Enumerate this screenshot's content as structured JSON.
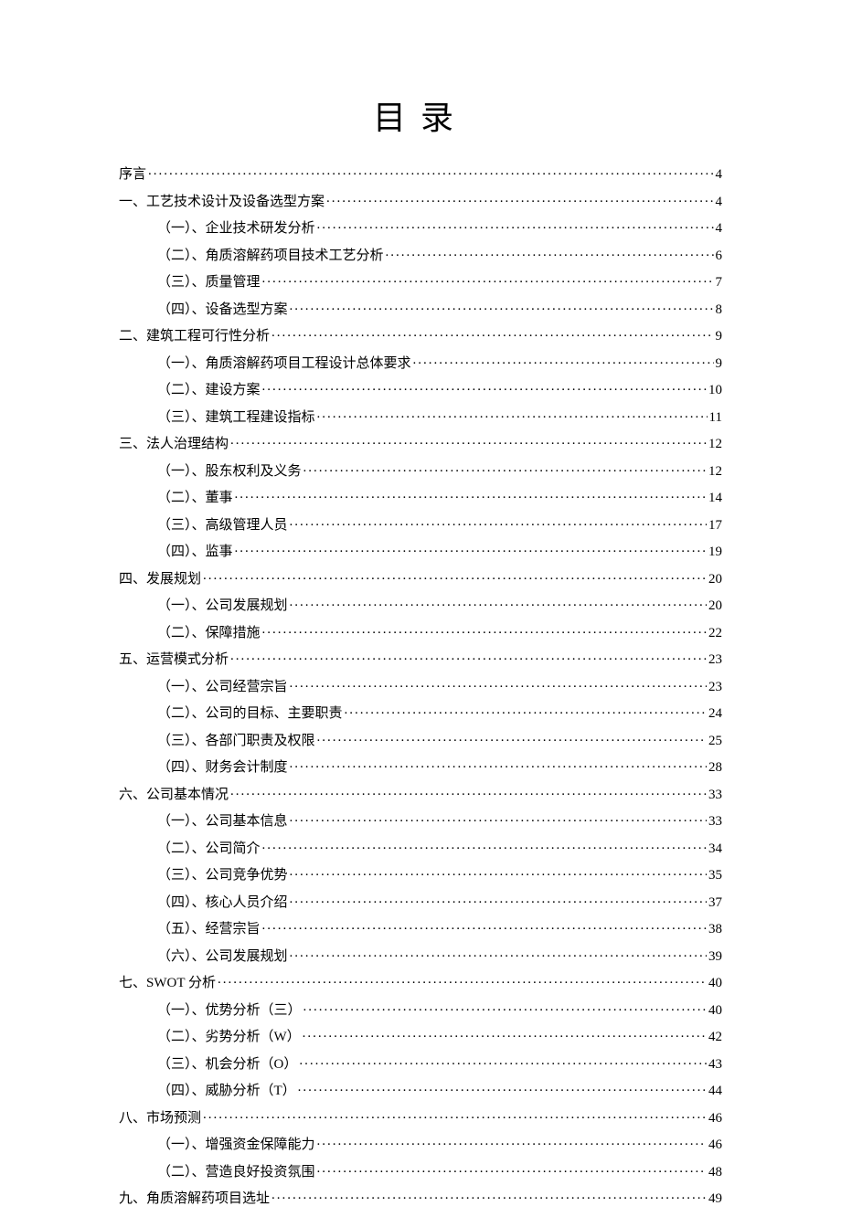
{
  "title": "目录",
  "entries": [
    {
      "level": 0,
      "label": "序言",
      "page": "4"
    },
    {
      "level": 0,
      "label": "一、工艺技术设计及设备选型方案",
      "page": "4"
    },
    {
      "level": 1,
      "label": "（一）、企业技术研发分析",
      "page": "4"
    },
    {
      "level": 1,
      "label": "（二）、角质溶解药项目技术工艺分析",
      "page": "6"
    },
    {
      "level": 1,
      "label": "（三）、质量管理",
      "page": "7"
    },
    {
      "level": 1,
      "label": "（四）、设备选型方案",
      "page": "8"
    },
    {
      "level": 0,
      "label": "二、建筑工程可行性分析",
      "page": "9"
    },
    {
      "level": 1,
      "label": "（一）、角质溶解药项目工程设计总体要求",
      "page": "9"
    },
    {
      "level": 1,
      "label": "（二）、建设方案",
      "page": "10"
    },
    {
      "level": 1,
      "label": "（三）、建筑工程建设指标",
      "page": "11"
    },
    {
      "level": 0,
      "label": "三、法人治理结构",
      "page": "12"
    },
    {
      "level": 1,
      "label": "（一）、股东权利及义务",
      "page": "12"
    },
    {
      "level": 1,
      "label": "（二）、董事",
      "page": "14"
    },
    {
      "level": 1,
      "label": "（三）、高级管理人员",
      "page": "17"
    },
    {
      "level": 1,
      "label": "（四）、监事",
      "page": "19"
    },
    {
      "level": 0,
      "label": "四、发展规划",
      "page": "20"
    },
    {
      "level": 1,
      "label": "（一）、公司发展规划",
      "page": "20"
    },
    {
      "level": 1,
      "label": "（二）、保障措施",
      "page": "22"
    },
    {
      "level": 0,
      "label": "五、运营模式分析",
      "page": "23"
    },
    {
      "level": 1,
      "label": "（一）、公司经营宗旨",
      "page": "23"
    },
    {
      "level": 1,
      "label": "（二）、公司的目标、主要职责",
      "page": "24"
    },
    {
      "level": 1,
      "label": "（三）、各部门职责及权限",
      "page": "25"
    },
    {
      "level": 1,
      "label": "（四）、财务会计制度",
      "page": "28"
    },
    {
      "level": 0,
      "label": "六、公司基本情况",
      "page": "33"
    },
    {
      "level": 1,
      "label": "（一）、公司基本信息",
      "page": "33"
    },
    {
      "level": 1,
      "label": "（二）、公司简介",
      "page": "34"
    },
    {
      "level": 1,
      "label": "（三）、公司竞争优势",
      "page": "35"
    },
    {
      "level": 1,
      "label": "（四）、核心人员介绍",
      "page": "37"
    },
    {
      "level": 1,
      "label": "（五）、经营宗旨",
      "page": "38"
    },
    {
      "level": 1,
      "label": "（六）、公司发展规划",
      "page": "39"
    },
    {
      "level": 0,
      "label": "七、SWOT 分析",
      "page": "40"
    },
    {
      "level": 1,
      "label": "（一）、优势分析（三）",
      "page": "40"
    },
    {
      "level": 1,
      "label": "（二）、劣势分析（W）",
      "page": "42"
    },
    {
      "level": 1,
      "label": "（三）、机会分析（O）",
      "page": "43"
    },
    {
      "level": 1,
      "label": "（四）、威胁分析（T）",
      "page": "44"
    },
    {
      "level": 0,
      "label": "八、市场预测",
      "page": "46"
    },
    {
      "level": 1,
      "label": "（一）、增强资金保障能力",
      "page": "46"
    },
    {
      "level": 1,
      "label": "（二）、营造良好投资氛围",
      "page": "48"
    },
    {
      "level": 0,
      "label": "九、角质溶解药项目选址",
      "page": "49"
    }
  ]
}
